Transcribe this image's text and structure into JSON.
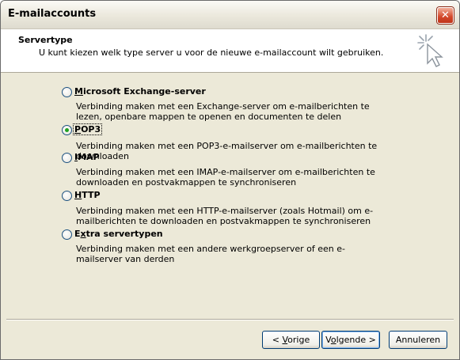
{
  "window": {
    "title": "E-mailaccounts",
    "close_glyph": "✕"
  },
  "header": {
    "title": "Servertype",
    "subtitle": "U kunt kiezen welk type server u voor de nieuwe e-mailaccount wilt gebruiken.",
    "icon": "wizard-cursor-icon"
  },
  "options": [
    {
      "label": "Microsoft Exchange-server",
      "accel": "M",
      "rest": "icrosoft Exchange-server",
      "checked": false,
      "description": "Verbinding maken met een Exchange-server om e-mailberichten te lezen, openbare mappen te openen en documenten te delen"
    },
    {
      "label": "POP3",
      "accel": "P",
      "rest": "OP3",
      "checked": true,
      "description": "Verbinding maken met een POP3-e-mailserver om e-mailberichten te downloaden"
    },
    {
      "label": "IMAP",
      "accel": "I",
      "rest": "MAP",
      "checked": false,
      "description": "Verbinding maken met een IMAP-e-mailserver om e-mailberichten te downloaden en postvakmappen te synchroniseren"
    },
    {
      "label": "HTTP",
      "accel": "H",
      "rest": "TTP",
      "checked": false,
      "description": "Verbinding maken met een HTTP-e-mailserver (zoals Hotmail) om e-mailberichten te downloaden en postvakmappen te synchroniseren"
    },
    {
      "label": "Extra servertypen",
      "pre": "E",
      "accel": "x",
      "rest": "tra servertypen",
      "checked": false,
      "description": "Verbinding maken met een andere werkgroepserver of een e-mailserver van derden"
    }
  ],
  "buttons": {
    "back": {
      "pre": "< ",
      "accel": "V",
      "rest": "orige"
    },
    "next": {
      "pre": "V",
      "accel": "o",
      "rest": "lgende >"
    },
    "cancel": {
      "label": "Annuleren"
    }
  }
}
